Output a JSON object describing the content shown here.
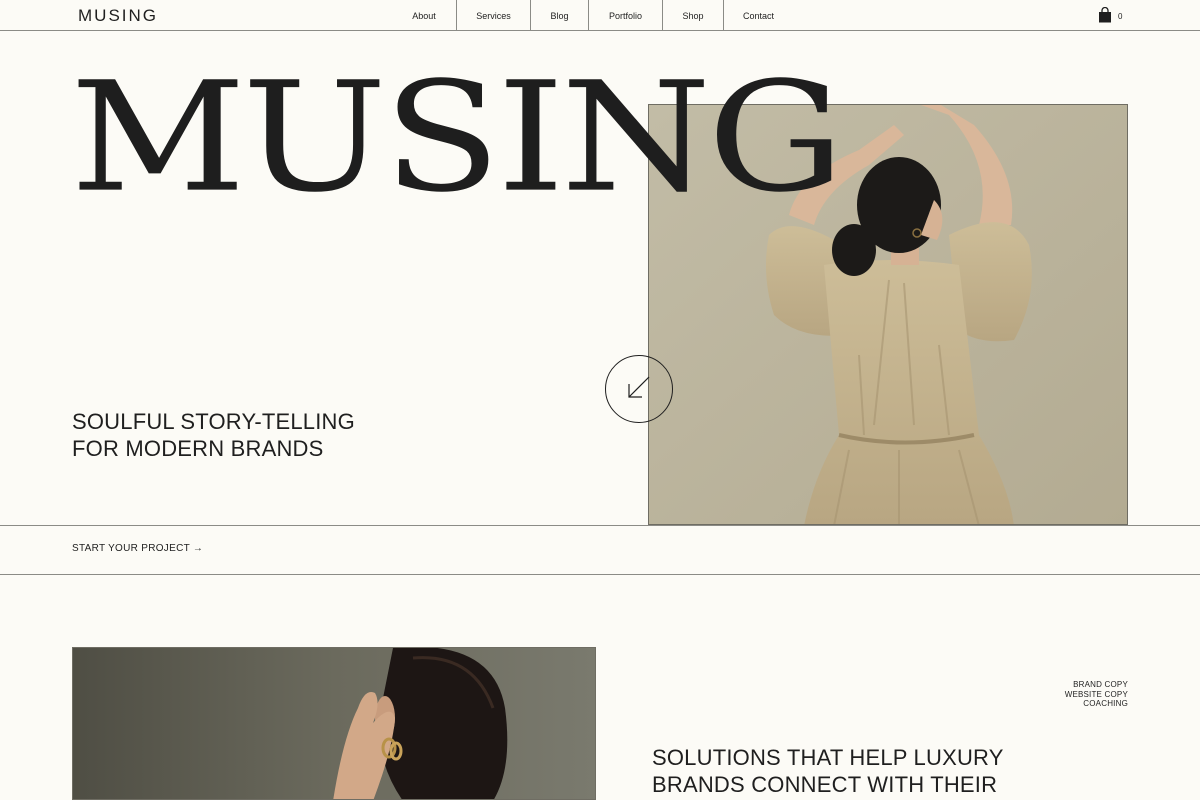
{
  "header": {
    "logo": "MUSING",
    "menu": [
      {
        "label": "About"
      },
      {
        "label": "Services"
      },
      {
        "label": "Blog"
      },
      {
        "label": "Portfolio"
      },
      {
        "label": "Shop"
      },
      {
        "label": "Contact"
      }
    ],
    "cart_count": "0"
  },
  "hero": {
    "wordmark": "MUSING",
    "tagline_line1": "SOULFUL STORY-TELLING",
    "tagline_line2": "FOR MODERN BRANDS"
  },
  "cta": {
    "label": "START YOUR PROJECT →"
  },
  "services": {
    "items": [
      "BRAND COPY",
      "WEBSITE COPY",
      "COACHING"
    ],
    "headline_line1": "SOLUTIONS THAT HELP LUXURY",
    "headline_line2": "BRANDS CONNECT WITH THEIR"
  },
  "colors": {
    "background": "#fcfbf6",
    "text": "#1f1f1f",
    "rule": "#8b8b86",
    "hero_photo_bg": "#bcb59e",
    "dress": "#c4b38f",
    "second_photo_bg": "#5f5e53"
  }
}
